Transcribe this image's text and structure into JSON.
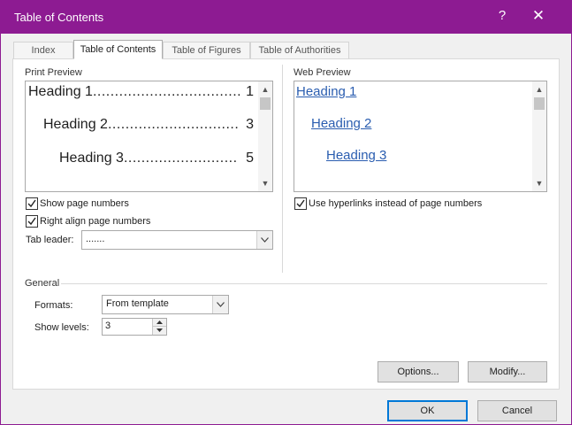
{
  "window": {
    "title": "Table of Contents",
    "help_glyph": "?",
    "close_glyph": "✕",
    "accent_color": "#8d1b92"
  },
  "tabs": [
    {
      "label": "Index",
      "active": false
    },
    {
      "label": "Table of Contents",
      "active": true
    },
    {
      "label": "Table of Figures",
      "active": false
    },
    {
      "label": "Table of Authorities",
      "active": false
    }
  ],
  "print_preview": {
    "label": "Print Preview",
    "entries": [
      {
        "text": "Heading 1",
        "dots": "..................................",
        "page": "1"
      },
      {
        "text": "Heading 2",
        "dots": "..............................",
        "page": "3"
      },
      {
        "text": "Heading 3",
        "dots": "..........................",
        "page": "5"
      }
    ]
  },
  "web_preview": {
    "label": "Web Preview",
    "entries": [
      "Heading 1",
      "Heading 2",
      "Heading 3"
    ],
    "link_color": "#2a5db0"
  },
  "options": {
    "show_page_numbers": {
      "label": "Show page numbers",
      "checked": true
    },
    "right_align": {
      "label": "Right align page numbers",
      "checked": true
    },
    "use_hyperlinks": {
      "label": "Use hyperlinks instead of page numbers",
      "checked": true
    },
    "tab_leader": {
      "label": "Tab leader:",
      "value": "......."
    }
  },
  "general": {
    "label": "General",
    "formats": {
      "label": "Formats:",
      "value": "From template"
    },
    "show_levels": {
      "label": "Show levels:",
      "value": "3"
    }
  },
  "buttons": {
    "options": "Options...",
    "modify": "Modify...",
    "ok": "OK",
    "cancel": "Cancel"
  }
}
